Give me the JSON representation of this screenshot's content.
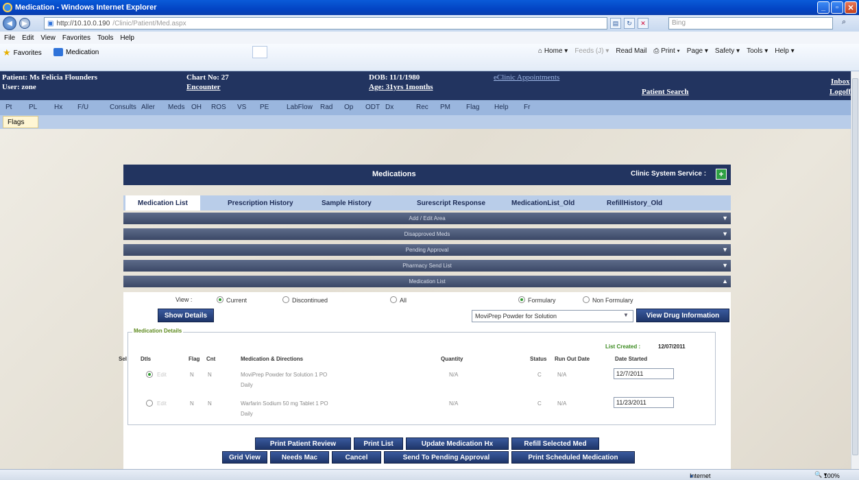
{
  "browser": {
    "title": "Medication - Windows Internet Explorer",
    "address_host": "http://10.10.0.190",
    "address_path": "/Clinic/Patient/Med.aspx",
    "search_placeholder": "Bing",
    "menu": [
      "File",
      "Edit",
      "View",
      "Favorites",
      "Tools",
      "Help"
    ],
    "favorites_label": "Favorites",
    "tab_label": "Medication",
    "commands": [
      "Home",
      "Feeds (J)",
      "Read Mail",
      "Print",
      "Page",
      "Safety",
      "Tools",
      "Help"
    ],
    "status_zone": "Internet",
    "zoom": "100%"
  },
  "header": {
    "patient": "Patient: Ms Felicia Flounders",
    "user": "User:  zone",
    "chart": "Chart No: 27",
    "encounter": "Encounter",
    "dob": "DOB: 11/1/1980",
    "age": "Age: 31yrs 1months",
    "appointments": "eClinic Appointments",
    "patient_search": "Patient Search",
    "inbox": "Inbox",
    "logoff": "Logoff"
  },
  "nav": {
    "items": [
      "Pt",
      "PL",
      "Hx",
      "F/U",
      "Consults",
      "Aller",
      "Meds",
      "OH",
      "ROS",
      "VS",
      "PE",
      "LabFlow",
      "Rad",
      "Op",
      "ODT",
      "Dx",
      "Rec",
      "PM",
      "Flag",
      "Help",
      "Fr"
    ],
    "flags_tab": "Flags"
  },
  "panel": {
    "title": "Medications",
    "service": "Clinic System Service :"
  },
  "tabs": [
    "Medication List",
    "Prescription History",
    "Sample History",
    "Surescript Response",
    "MedicationList_Old",
    "RefillHistory_Old"
  ],
  "sections": [
    "Add / Edit Area",
    "Disapproved Meds",
    "Pending Approval",
    "Pharmacy Send List",
    "Medication List"
  ],
  "view": {
    "label": "View :",
    "options": [
      "Current",
      "Discontinued",
      "All"
    ],
    "formulary": [
      "Formulary",
      "Non Formulary"
    ],
    "show_details": "Show Details",
    "drug_selected": "MoviPrep Powder for Solution",
    "view_drug_info": "View Drug Information"
  },
  "details": {
    "legend": "Medication Details",
    "list_created_label": "List Created :",
    "list_created_date": "12/07/2011",
    "columns": [
      "Sel",
      "Dtls",
      "Flag",
      "Cnt",
      "Medication & Directions",
      "Quantity",
      "Status",
      "Run Out Date",
      "Date Started"
    ],
    "rows": [
      {
        "dtls": "Edit",
        "flag": "N",
        "cnt": "N",
        "med1": "MoviPrep Powder for Solution 1 PO",
        "med2": "Daily",
        "qty": "N/A",
        "status": "C",
        "runout": "N/A",
        "started": "12/7/2011"
      },
      {
        "dtls": "Edit",
        "flag": "N",
        "cnt": "N",
        "med1": "Warfarin Sodium 50 mg Tablet 1 PO",
        "med2": "Daily",
        "qty": "N/A",
        "status": "C",
        "runout": "N/A",
        "started": "11/23/2011"
      }
    ]
  },
  "buttons": {
    "row1": [
      "Print Patient Review",
      "Print List",
      "Update Medication Hx",
      "Refill Selected Med"
    ],
    "row2": [
      "Grid View",
      "Needs Mac",
      "Cancel",
      "Send To Pending Approval",
      "Print Scheduled Medication"
    ]
  }
}
